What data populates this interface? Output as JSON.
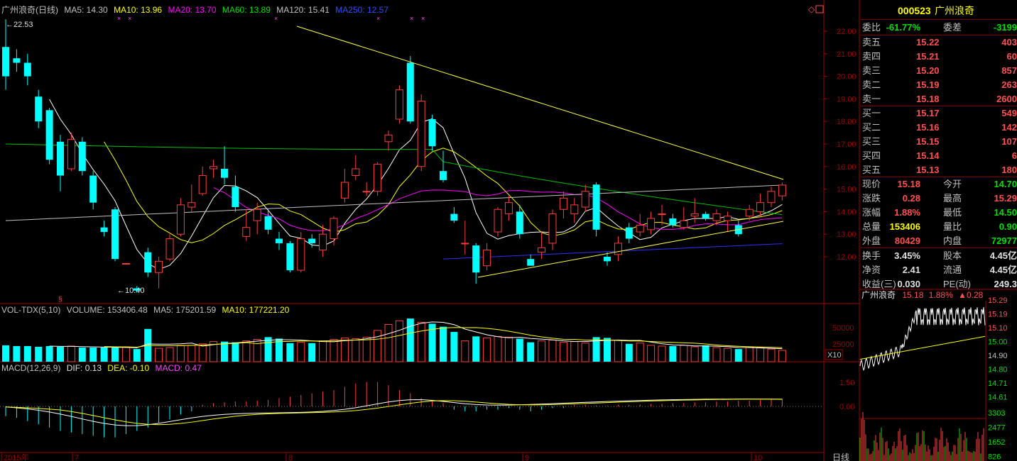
{
  "main_legend": {
    "title": "广州浪奇(日线)",
    "ma5": "MA5: 14.30",
    "ma10": "MA10: 13.96",
    "ma20": "MA20: 13.70",
    "ma60": "MA60: 13.89",
    "ma120": "MA120: 15.41",
    "ma250": "MA250: 12.57"
  },
  "price_axis": [
    "22.00",
    "21.00",
    "20.00",
    "19.00",
    "18.00",
    "17.00",
    "16.00",
    "15.00",
    "14.00",
    "13.00",
    "12.00"
  ],
  "price_annotations": {
    "high": "22.53",
    "low": "10.40"
  },
  "vol_legend": {
    "name": "VOL-TDX(5,10)",
    "volume": "VOLUME: 153406.48",
    "ma5": "MA5: 175201.59",
    "ma10": "MA10: 177221.20"
  },
  "vol_axis": [
    "50000",
    "25000"
  ],
  "vol_unit": "X10",
  "macd_legend": {
    "name": "MACD(12,26,9)",
    "dif": "DIF: 0.13",
    "dea": "DEA: -0.10",
    "macd": "MACD: 0.47"
  },
  "macd_axis": [
    "1.50",
    "0.00"
  ],
  "date_labels": [
    "2015年",
    "7",
    "8",
    "9",
    "10"
  ],
  "period_button": "日线",
  "quote": {
    "code": "000523",
    "name": "广州浪奇",
    "weibi_label": "委比",
    "weibi": "-61.77%",
    "weicha_label": "委差",
    "weicha": "-3199",
    "asks": [
      {
        "label": "卖五",
        "price": "15.22",
        "vol": "403"
      },
      {
        "label": "卖四",
        "price": "15.21",
        "vol": "60"
      },
      {
        "label": "卖三",
        "price": "15.20",
        "vol": "857"
      },
      {
        "label": "卖二",
        "price": "15.19",
        "vol": "263"
      },
      {
        "label": "卖一",
        "price": "15.18",
        "vol": "2600"
      }
    ],
    "bids": [
      {
        "label": "买一",
        "price": "15.17",
        "vol": "549"
      },
      {
        "label": "买二",
        "price": "15.16",
        "vol": "142"
      },
      {
        "label": "买三",
        "price": "15.15",
        "vol": "107"
      },
      {
        "label": "买四",
        "price": "15.14",
        "vol": "6"
      },
      {
        "label": "买五",
        "price": "15.13",
        "vol": "180"
      }
    ],
    "stats": [
      {
        "l1": "现价",
        "v1": "15.18",
        "c1": "red",
        "l2": "今开",
        "v2": "14.70",
        "c2": "green"
      },
      {
        "l1": "涨跌",
        "v1": "0.28",
        "c1": "red",
        "l2": "最高",
        "v2": "15.29",
        "c2": "red"
      },
      {
        "l1": "涨幅",
        "v1": "1.88%",
        "c1": "red",
        "l2": "最低",
        "v2": "14.50",
        "c2": "green"
      },
      {
        "l1": "总量",
        "v1": "153406",
        "c1": "yellow",
        "l2": "量比",
        "v2": "0.90",
        "c2": "green"
      },
      {
        "l1": "外盘",
        "v1": "80429",
        "c1": "red",
        "l2": "内盘",
        "v2": "72977",
        "c2": "green"
      }
    ],
    "stats2": [
      {
        "l1": "换手",
        "v1": "3.45%",
        "l2": "股本",
        "v2": "4.45亿"
      },
      {
        "l1": "净资",
        "v1": "2.41",
        "l2": "流通",
        "v2": "4.45亿"
      },
      {
        "l1": "收益(三)",
        "v1": "0.030",
        "l2": "PE(动)",
        "v2": "249.3"
      }
    ]
  },
  "mini": {
    "name": "广州浪奇",
    "price": "15.18",
    "pct": "1.88%",
    "chg": "▲0.28",
    "price_axis": [
      "15.29",
      "15.19",
      "15.10",
      "15.00",
      "14.90",
      "14.80",
      "14.71",
      "14.61"
    ],
    "vol_axis": [
      "3303",
      "2477",
      "1652",
      "826"
    ]
  },
  "colors": {
    "up": "#ff3c3c",
    "down": "#00ffff",
    "ma5": "#ffffff",
    "ma10": "#ffff00",
    "ma20": "#ff00ff",
    "ma60": "#00c000",
    "ma120": "#c0c0c0",
    "ma250": "#3030ff"
  },
  "chart_data": {
    "type": "candlestick",
    "title": "广州浪奇(日线)",
    "candles": [
      {
        "o": 21.3,
        "c": 20.0,
        "h": 22.53,
        "l": 19.4
      },
      {
        "o": 20.8,
        "c": 20.6,
        "h": 21.2,
        "l": 20.2
      },
      {
        "o": 20.6,
        "c": 20.0,
        "h": 21.0,
        "l": 19.6
      },
      {
        "o": 19.1,
        "c": 18.0,
        "h": 19.4,
        "l": 17.7
      },
      {
        "o": 18.5,
        "c": 16.3,
        "h": 18.6,
        "l": 16.1
      },
      {
        "o": 17.1,
        "c": 15.6,
        "h": 17.4,
        "l": 14.9
      },
      {
        "o": 15.9,
        "c": 17.2,
        "h": 17.5,
        "l": 15.8
      },
      {
        "o": 17.1,
        "c": 15.8,
        "h": 17.3,
        "l": 15.6
      },
      {
        "o": 15.6,
        "c": 14.4,
        "h": 15.8,
        "l": 14.1
      },
      {
        "o": 13.3,
        "c": 13.1,
        "h": 13.6,
        "l": 12.9
      },
      {
        "o": 14.1,
        "c": 11.9,
        "h": 14.2,
        "l": 11.8
      },
      {
        "o": 11.7,
        "c": 11.7,
        "h": 11.7,
        "l": 11.7
      },
      {
        "o": 10.6,
        "c": 10.5,
        "h": 10.7,
        "l": 10.4
      },
      {
        "o": 12.2,
        "c": 11.3,
        "h": 12.4,
        "l": 11.1
      },
      {
        "o": 11.3,
        "c": 11.8,
        "h": 12.0,
        "l": 10.6
      },
      {
        "o": 11.9,
        "c": 12.8,
        "h": 13.0,
        "l": 11.8
      },
      {
        "o": 13.0,
        "c": 14.3,
        "h": 14.6,
        "l": 12.9
      },
      {
        "o": 14.2,
        "c": 14.4,
        "h": 15.2,
        "l": 14.0
      },
      {
        "o": 14.8,
        "c": 15.6,
        "h": 16.0,
        "l": 14.7
      },
      {
        "o": 15.9,
        "c": 16.0,
        "h": 16.3,
        "l": 15.5
      },
      {
        "o": 15.9,
        "c": 15.5,
        "h": 16.9,
        "l": 15.2
      },
      {
        "o": 15.1,
        "c": 14.2,
        "h": 15.6,
        "l": 14.0
      },
      {
        "o": 12.9,
        "c": 13.3,
        "h": 14.1,
        "l": 12.7
      },
      {
        "o": 13.6,
        "c": 14.1,
        "h": 14.4,
        "l": 13.0
      },
      {
        "o": 13.8,
        "c": 13.2,
        "h": 14.1,
        "l": 13.0
      },
      {
        "o": 12.8,
        "c": 12.6,
        "h": 13.1,
        "l": 12.3
      },
      {
        "o": 12.6,
        "c": 11.4,
        "h": 12.7,
        "l": 11.3
      },
      {
        "o": 11.4,
        "c": 12.8,
        "h": 13.1,
        "l": 11.3
      },
      {
        "o": 12.8,
        "c": 12.6,
        "h": 13.0,
        "l": 12.4
      },
      {
        "o": 12.3,
        "c": 13.0,
        "h": 13.4,
        "l": 12.0
      },
      {
        "o": 12.8,
        "c": 13.7,
        "h": 13.8,
        "l": 12.5
      },
      {
        "o": 14.6,
        "c": 15.3,
        "h": 15.9,
        "l": 14.4
      },
      {
        "o": 15.6,
        "c": 15.9,
        "h": 16.5,
        "l": 15.4
      },
      {
        "o": 14.9,
        "c": 14.9,
        "h": 15.3,
        "l": 14.7
      },
      {
        "o": 14.9,
        "c": 16.1,
        "h": 16.2,
        "l": 14.7
      },
      {
        "o": 17.1,
        "c": 17.4,
        "h": 17.6,
        "l": 16.7
      },
      {
        "o": 18.1,
        "c": 19.4,
        "h": 19.6,
        "l": 17.9
      },
      {
        "o": 20.6,
        "c": 18.0,
        "h": 20.9,
        "l": 17.9
      },
      {
        "o": 16.0,
        "c": 18.9,
        "h": 19.2,
        "l": 15.8
      },
      {
        "o": 18.1,
        "c": 16.9,
        "h": 18.3,
        "l": 16.7
      },
      {
        "o": 15.8,
        "c": 15.4,
        "h": 16.7,
        "l": 15.3
      },
      {
        "o": 13.9,
        "c": 13.6,
        "h": 14.2,
        "l": 13.5
      },
      {
        "o": 12.6,
        "c": 12.6,
        "h": 13.6,
        "l": 12.1
      },
      {
        "o": 12.5,
        "c": 11.3,
        "h": 12.6,
        "l": 10.8
      },
      {
        "o": 11.6,
        "c": 12.3,
        "h": 12.6,
        "l": 11.4
      },
      {
        "o": 13.1,
        "c": 14.1,
        "h": 14.2,
        "l": 12.9
      },
      {
        "o": 13.9,
        "c": 14.4,
        "h": 14.7,
        "l": 13.6
      },
      {
        "o": 14.0,
        "c": 13.0,
        "h": 14.3,
        "l": 12.8
      },
      {
        "o": 11.9,
        "c": 11.6,
        "h": 12.1,
        "l": 11.6
      },
      {
        "o": 12.2,
        "c": 12.4,
        "h": 13.1,
        "l": 11.9
      },
      {
        "o": 12.6,
        "c": 13.9,
        "h": 14.1,
        "l": 12.3
      },
      {
        "o": 14.1,
        "c": 14.6,
        "h": 14.9,
        "l": 13.7
      },
      {
        "o": 13.9,
        "c": 14.3,
        "h": 14.6,
        "l": 13.5
      },
      {
        "o": 14.2,
        "c": 14.9,
        "h": 15.2,
        "l": 14.0
      },
      {
        "o": 15.2,
        "c": 13.2,
        "h": 15.3,
        "l": 12.9
      },
      {
        "o": 12.0,
        "c": 11.8,
        "h": 12.2,
        "l": 11.6
      },
      {
        "o": 12.1,
        "c": 12.6,
        "h": 12.9,
        "l": 11.8
      },
      {
        "o": 13.3,
        "c": 12.8,
        "h": 13.5,
        "l": 12.6
      },
      {
        "o": 13.1,
        "c": 13.4,
        "h": 13.9,
        "l": 12.9
      },
      {
        "o": 13.2,
        "c": 13.7,
        "h": 14.0,
        "l": 13.0
      },
      {
        "o": 13.9,
        "c": 13.9,
        "h": 14.3,
        "l": 13.4
      },
      {
        "o": 13.7,
        "c": 13.4,
        "h": 13.9,
        "l": 13.3
      },
      {
        "o": 13.3,
        "c": 13.6,
        "h": 14.2,
        "l": 13.2
      },
      {
        "o": 13.8,
        "c": 13.9,
        "h": 14.6,
        "l": 13.5
      },
      {
        "o": 13.9,
        "c": 13.7,
        "h": 14.0,
        "l": 13.6
      },
      {
        "o": 13.6,
        "c": 13.9,
        "h": 14.1,
        "l": 13.4
      },
      {
        "o": 13.6,
        "c": 13.8,
        "h": 14.0,
        "l": 13.1
      },
      {
        "o": 13.4,
        "c": 13.0,
        "h": 13.6,
        "l": 12.9
      },
      {
        "o": 13.8,
        "c": 14.1,
        "h": 14.3,
        "l": 13.6
      },
      {
        "o": 14.0,
        "c": 14.4,
        "h": 14.8,
        "l": 13.8
      },
      {
        "o": 14.4,
        "c": 14.9,
        "h": 15.1,
        "l": 14.2
      },
      {
        "o": 14.7,
        "c": 15.18,
        "h": 15.29,
        "l": 14.5
      }
    ],
    "volume": [
      22,
      21,
      21,
      20,
      21,
      20,
      21,
      19,
      19,
      19,
      19,
      20,
      17,
      44,
      18,
      19,
      22,
      22,
      24,
      27,
      27,
      26,
      28,
      30,
      33,
      31,
      25,
      26,
      25,
      28,
      30,
      32,
      31,
      33,
      42,
      50,
      55,
      58,
      53,
      51,
      47,
      40,
      28,
      34,
      32,
      34,
      33,
      31,
      26,
      28,
      29,
      26,
      27,
      25,
      33,
      32,
      29,
      24,
      25,
      22,
      21,
      21,
      22,
      20,
      22,
      19,
      18,
      17,
      19,
      19,
      17,
      15.3
    ],
    "macd_hist": [
      -0.6,
      -0.7,
      -0.9,
      -1.1,
      -1.3,
      -1.5,
      -1.6,
      -1.7,
      -1.8,
      -1.9,
      -1.9,
      -1.7,
      -1.5,
      -1.3,
      -1.0,
      -0.8,
      -0.5,
      -0.3,
      0.1,
      0.2,
      0.25,
      0.3,
      0.3,
      0.35,
      0.4,
      0.5,
      0.6,
      0.7,
      0.8,
      0.9,
      1.0,
      1.2,
      1.4,
      1.5,
      1.5,
      1.3,
      1.0,
      0.8,
      0.5,
      0.3,
      0.2,
      -0.2,
      -0.3,
      -0.3,
      -0.2,
      -0.2,
      -0.1,
      -0.2,
      -0.3,
      -0.2,
      -0.1,
      -0.1,
      0.1,
      0.1,
      0.05,
      0.05,
      0.1,
      0.1,
      0.12,
      0.15,
      0.15,
      0.2,
      0.2,
      0.25,
      0.25,
      0.3,
      0.3,
      0.35,
      0.35,
      0.4,
      0.45,
      0.47
    ],
    "ylim": [
      10,
      22.6
    ]
  }
}
